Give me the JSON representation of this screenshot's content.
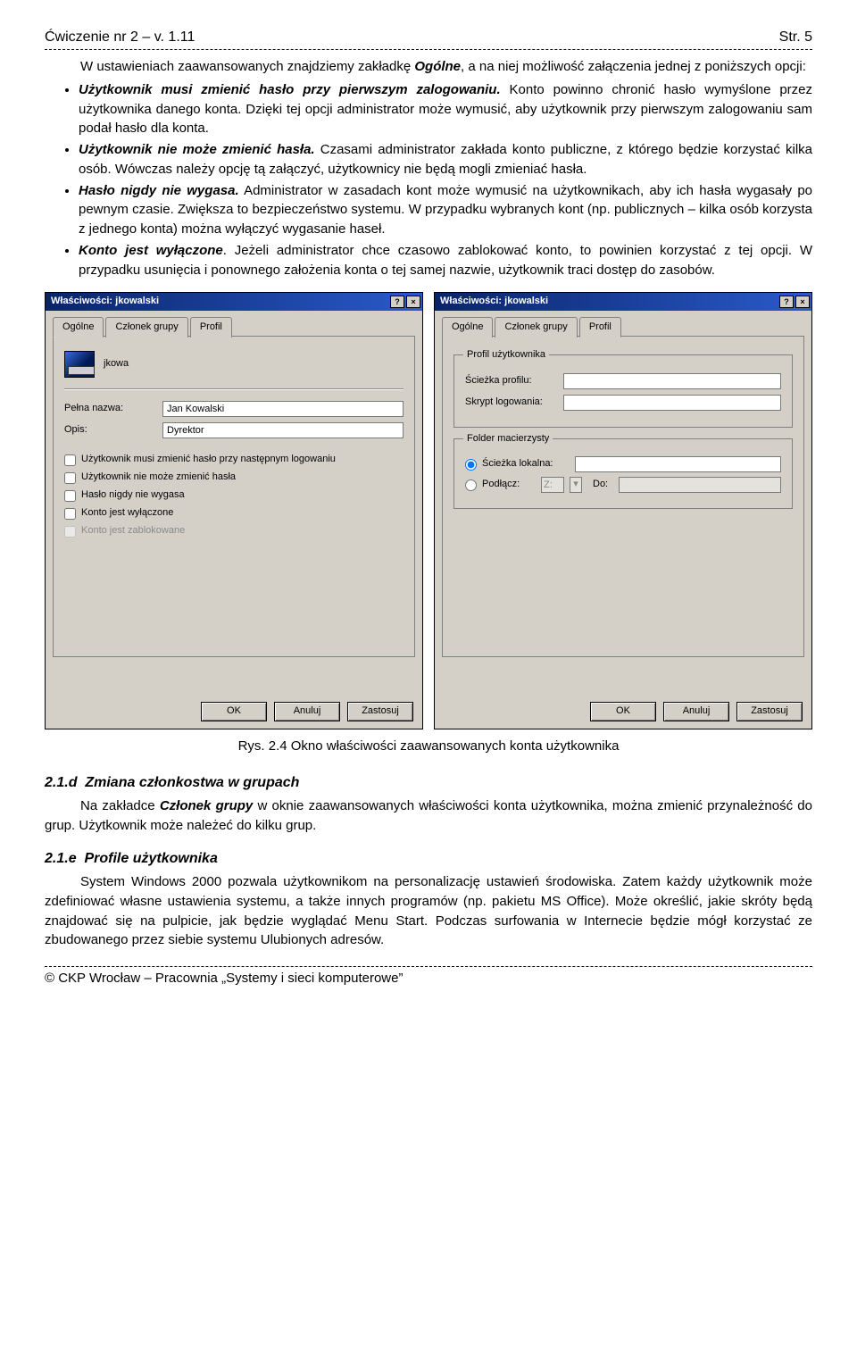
{
  "header": {
    "left": "Ćwiczenie nr 2 – v. 1.11",
    "right": "Str. 5"
  },
  "intro_prefix": "W ustawieniach zaawansowanych znajdziemy zakładkę ",
  "intro_bold": "Ogólne",
  "intro_suffix": ", a na niej możliwość załączenia jednej z poniższych opcji:",
  "bullets": [
    {
      "title": "Użytkownik musi zmienić hasło przy pierwszym zalogowaniu.",
      "text": " Konto powinno chronić hasło wymyślone przez użytkownika danego konta. Dzięki tej opcji administrator może wymusić, aby użytkownik przy pierwszym zalogowaniu sam podał hasło dla konta."
    },
    {
      "title": "Użytkownik nie może zmienić hasła.",
      "text": " Czasami administrator zakłada konto publiczne, z którego będzie korzystać kilka osób. Wówczas należy opcję tą załączyć, użytkownicy nie będą mogli zmieniać hasła."
    },
    {
      "title": "Hasło nigdy nie wygasa.",
      "text": " Administrator w zasadach kont może wymusić na użytkownikach, aby ich hasła wygasały po pewnym czasie. Zwiększa to bezpieczeństwo systemu. W przypadku wybranych kont (np. publicznych – kilka osób korzysta z jednego konta) można wyłączyć wygasanie haseł."
    },
    {
      "title": "Konto jest wyłączone",
      "text": ". Jeżeli administrator chce czasowo zablokować konto, to powinien korzystać z tej opcji. W przypadku usunięcia i ponownego założenia konta o tej samej nazwie, użytkownik traci dostęp do zasobów."
    }
  ],
  "dlg_title": "Właściwości: jkowalski",
  "tabs": {
    "ogolne": "Ogólne",
    "czlonek": "Członek grupy",
    "profil": "Profil"
  },
  "left_dlg": {
    "user": "jkowa",
    "fullname_lbl": "Pełna nazwa:",
    "fullname_val": "Jan Kowalski",
    "desc_lbl": "Opis:",
    "desc_val": "Dyrektor",
    "opts": [
      "Użytkownik musi zmienić hasło przy następnym logowaniu",
      "Użytkownik nie może zmienić hasła",
      "Hasło nigdy nie wygasa",
      "Konto jest wyłączone",
      "Konto jest zablokowane"
    ]
  },
  "right_dlg": {
    "grp1": "Profil użytkownika",
    "path_lbl": "Ścieżka profilu:",
    "script_lbl": "Skrypt logowania:",
    "grp2": "Folder macierzysty",
    "local_lbl": "Ścieżka lokalna:",
    "connect_lbl": "Podłącz:",
    "drive": "Z:",
    "do_lbl": "Do:"
  },
  "buttons": {
    "ok": "OK",
    "cancel": "Anuluj",
    "apply": "Zastosuj"
  },
  "caption": "Rys. 2.4 Okno właściwości zaawansowanych konta użytkownika",
  "sec_d_num": "2.1.d",
  "sec_d_title": "Zmiana członkostwa w grupach",
  "sec_d_p_a": "Na zakładce ",
  "sec_d_p_b": "Członek grupy",
  "sec_d_p_c": " w oknie zaawansowanych właściwości konta użytkownika, można zmienić przynależność do grup. Użytkownik może należeć do kilku grup.",
  "sec_e_num": "2.1.e",
  "sec_e_title": "Profile użytkownika",
  "sec_e_p": "System Windows 2000 pozwala użytkownikom na personalizację ustawień środowiska. Zatem każdy użytkownik może zdefiniować własne ustawienia systemu, a także innych programów (np. pakietu MS Office). Może określić, jakie skróty będą znajdować się na pulpicie, jak będzie wyglądać Menu Start. Podczas surfowania w Internecie będzie mógł korzystać ze zbudowanego przez siebie systemu Ulubionych adresów.",
  "footer": "© CKP Wrocław – Pracownia „Systemy i sieci komputerowe”"
}
